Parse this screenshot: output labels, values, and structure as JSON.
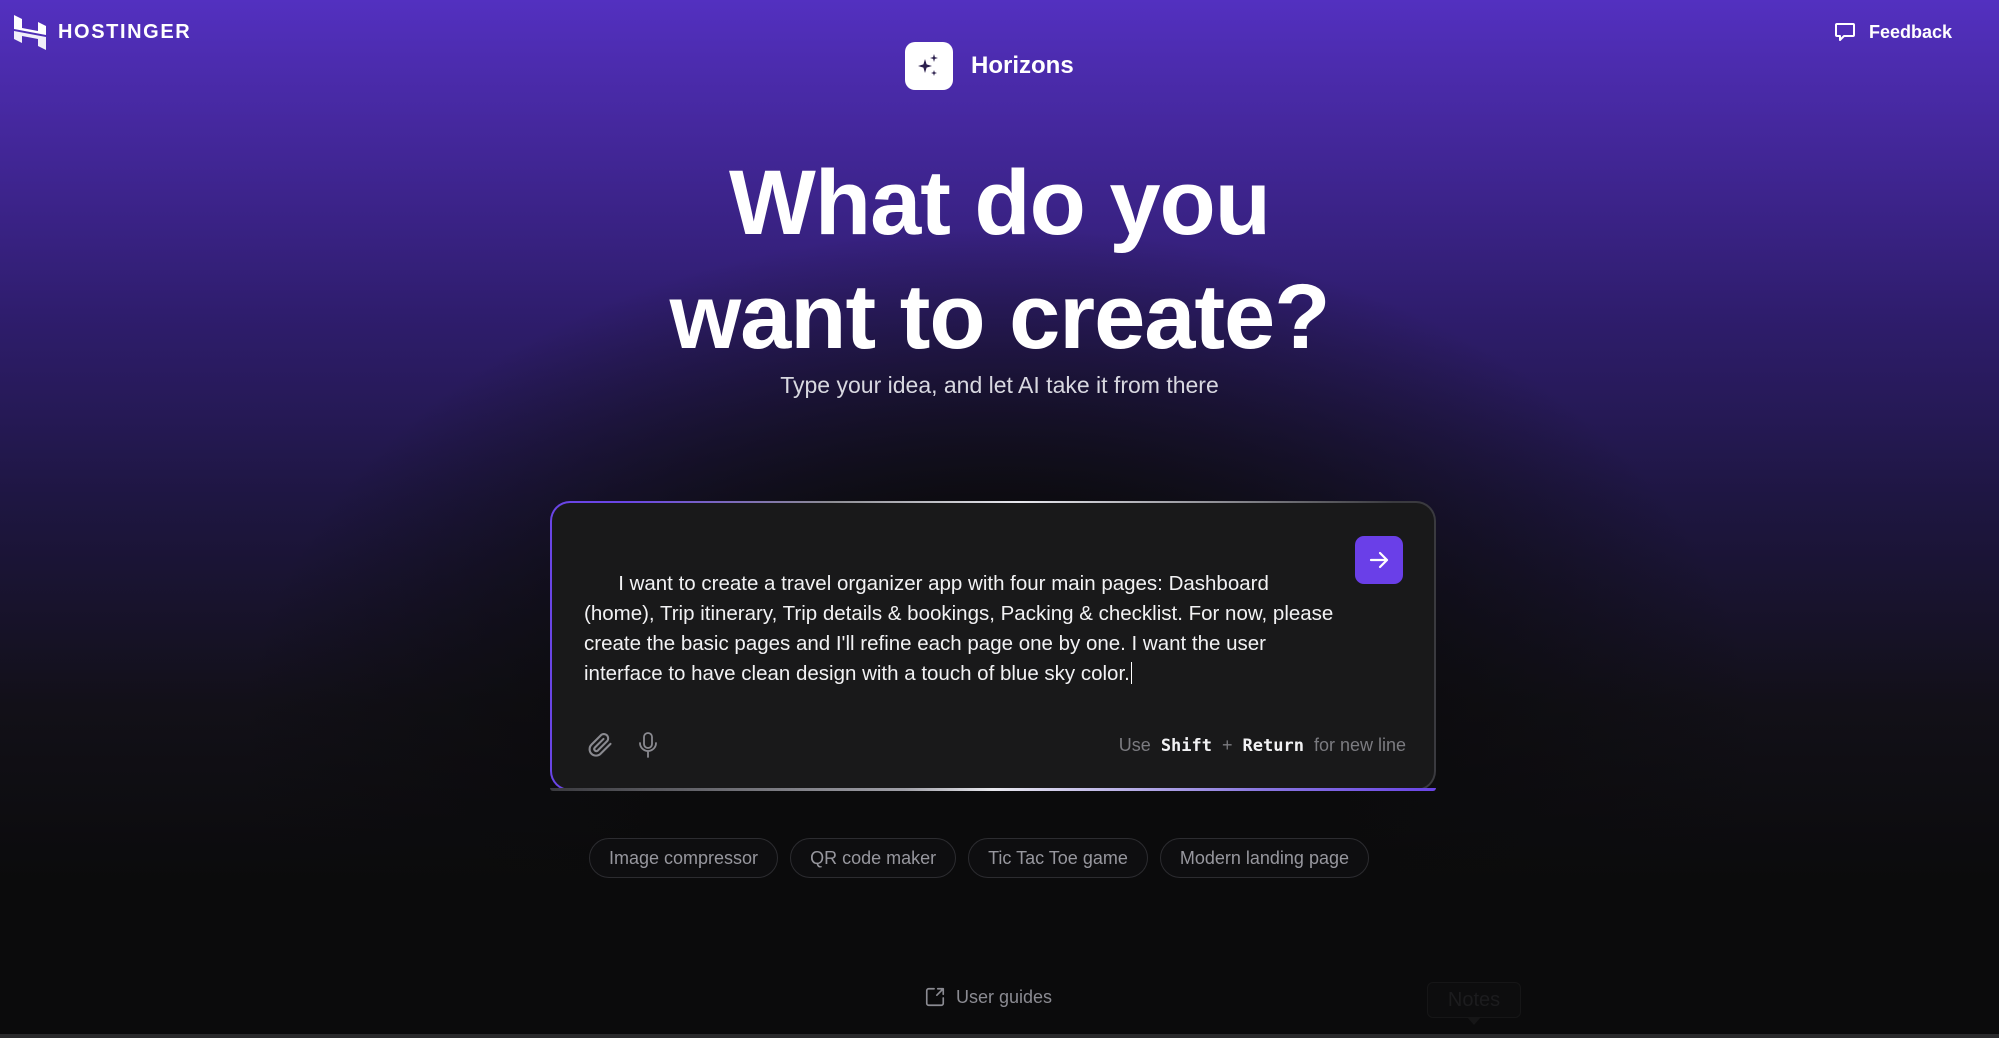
{
  "header": {
    "brand_name": "HOSTINGER",
    "brand_icon": "hostinger-logo-icon",
    "product_name": "Horizons",
    "product_icon": "sparkles-icon",
    "feedback_label": "Feedback",
    "feedback_icon": "chat-bubble-icon"
  },
  "hero": {
    "title_line1": "What do you",
    "title_line2": "want to create?",
    "subtitle": "Type your idea, and let AI take it from there"
  },
  "prompt": {
    "value": "I want to create a travel organizer app with four main pages: Dashboard (home), Trip itinerary, Trip details & bookings, Packing & checklist. For now, please create the basic pages and I'll refine each page one by one. I want the user interface to have clean design with a touch of blue sky color.",
    "send_icon": "arrow-right-icon",
    "attach_icon": "paperclip-icon",
    "mic_icon": "microphone-icon",
    "hint": {
      "prefix": "Use",
      "key1": "Shift",
      "plus": "+",
      "key2": "Return",
      "suffix": "for new line"
    }
  },
  "suggestions": [
    {
      "label": "Image compressor"
    },
    {
      "label": "QR code maker"
    },
    {
      "label": "Tic Tac Toe game"
    },
    {
      "label": "Modern landing page"
    }
  ],
  "footer": {
    "guides_label": "User guides",
    "guides_icon": "external-link-icon",
    "notes_tooltip": "Notes"
  },
  "colors": {
    "accent": "#6a3fe8",
    "background_top": "#5330c0",
    "background_bottom": "#0b0b0c",
    "card": "#19191a"
  }
}
